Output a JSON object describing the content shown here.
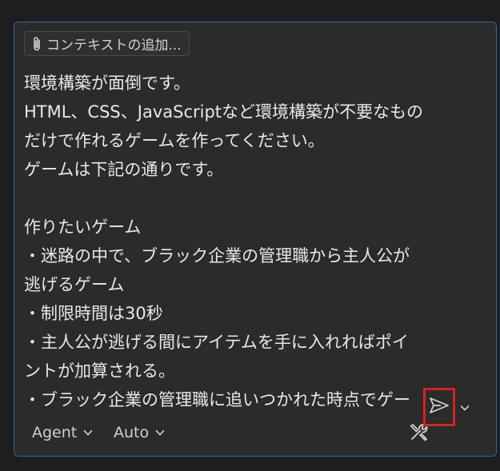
{
  "context_button": {
    "label": "コンテキストの追加...",
    "icon": "paperclip-icon"
  },
  "prompt_lines": [
    "環境構築が面倒です。",
    "HTML、CSS、JavaScriptなど環境構築が不要なもの",
    "だけで作れるゲームを作ってください。",
    "ゲームは下記の通りです。",
    "",
    "作りたいゲーム",
    "・迷路の中で、ブラック企業の管理職から主人公が",
    "逃げるゲーム",
    "・制限時間は30秒",
    "・主人公が逃げる間にアイテムを手に入れればポイ",
    "ントが加算される。",
    "・ブラック企業の管理職に追いつかれた時点でゲー"
  ],
  "toolbar": {
    "agent_label": "Agent",
    "model_label": "Auto",
    "tools_icon": "tools-icon",
    "send_icon": "send-icon",
    "send_menu_icon": "chevron-down-icon"
  },
  "colors": {
    "page_background": "#1e1e1e",
    "input_background": "#2b2b2b",
    "input_border": "#2d6aa3",
    "highlight_box": "#d82121",
    "text": "#e8e8e8"
  }
}
